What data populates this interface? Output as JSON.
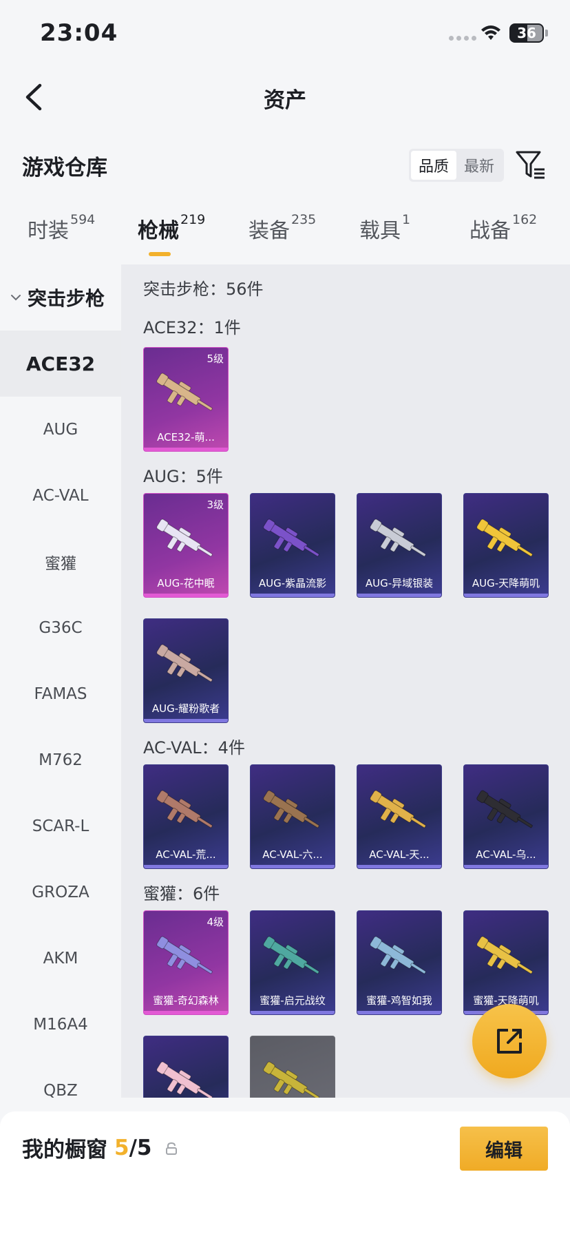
{
  "status": {
    "time": "23:04",
    "battery": "36"
  },
  "header": {
    "title": "资产"
  },
  "warehouse": {
    "title": "游戏仓库",
    "sort_options": [
      "品质",
      "最新"
    ],
    "active_sort": 0
  },
  "tabs": [
    {
      "label": "时装",
      "count": "594"
    },
    {
      "label": "枪械",
      "count": "219"
    },
    {
      "label": "装备",
      "count": "235"
    },
    {
      "label": "载具",
      "count": "1"
    },
    {
      "label": "战备",
      "count": "162"
    }
  ],
  "active_tab": 1,
  "sidebar": {
    "group": "突击步枪",
    "items": [
      "ACE32",
      "AUG",
      "AC-VAL",
      "蜜獾",
      "G36C",
      "FAMAS",
      "M762",
      "SCAR-L",
      "GROZA",
      "AKM",
      "M16A4",
      "QBZ"
    ],
    "active": 0
  },
  "content": {
    "total": "突击步枪：56件",
    "sections": [
      {
        "title": "ACE32：1件",
        "cards": [
          {
            "name": "ACE32-萌...",
            "level": "5级",
            "rarity": "pink",
            "gun_color": "#d8b58a"
          }
        ]
      },
      {
        "title": "AUG：5件",
        "cards": [
          {
            "name": "AUG-花中眠",
            "level": "3级",
            "rarity": "pink",
            "gun_color": "#e8e4f4"
          },
          {
            "name": "AUG-紫晶流影",
            "level": "",
            "rarity": "purple",
            "gun_color": "#7b52c9"
          },
          {
            "name": "AUG-异域银装",
            "level": "",
            "rarity": "purple",
            "gun_color": "#c9ccd6"
          },
          {
            "name": "AUG-天降萌叽",
            "level": "",
            "rarity": "purple",
            "gun_color": "#f0c53a"
          },
          {
            "name": "AUG-耀粉歌者",
            "level": "",
            "rarity": "purple",
            "gun_color": "#c9a9a2"
          }
        ]
      },
      {
        "title": "AC-VAL：4件",
        "cards": [
          {
            "name": "AC-VAL-荒...",
            "level": "",
            "rarity": "purple",
            "gun_color": "#b07a6a"
          },
          {
            "name": "AC-VAL-六...",
            "level": "",
            "rarity": "purple",
            "gun_color": "#9a7350"
          },
          {
            "name": "AC-VAL-天...",
            "level": "",
            "rarity": "purple",
            "gun_color": "#e0b14a"
          },
          {
            "name": "AC-VAL-乌...",
            "level": "",
            "rarity": "purple",
            "gun_color": "#2e2d33"
          }
        ]
      },
      {
        "title": "蜜獾：6件",
        "cards": [
          {
            "name": "蜜獾-奇幻森林",
            "level": "4级",
            "rarity": "pink",
            "gun_color": "#8f8fe0"
          },
          {
            "name": "蜜獾-启元战纹",
            "level": "",
            "rarity": "purple",
            "gun_color": "#4fa8a0"
          },
          {
            "name": "蜜獾-鸡智如我",
            "level": "",
            "rarity": "purple",
            "gun_color": "#8db8d8"
          },
          {
            "name": "蜜獾-天降萌叽",
            "level": "",
            "rarity": "purple",
            "gun_color": "#e8c145"
          },
          {
            "name": "",
            "level": "",
            "rarity": "purple",
            "gun_color": "#f0c0d0"
          },
          {
            "name": "",
            "level": "",
            "rarity": "gray",
            "gun_color": "#c8b43a"
          }
        ]
      }
    ]
  },
  "showcase": {
    "label": "我的橱窗",
    "count": "5",
    "total": "/5",
    "edit_label": "编辑"
  },
  "colors": {
    "accent": "#f2b12c",
    "pink_rarity": "#c04ab0",
    "purple_rarity": "#3f2d82"
  }
}
